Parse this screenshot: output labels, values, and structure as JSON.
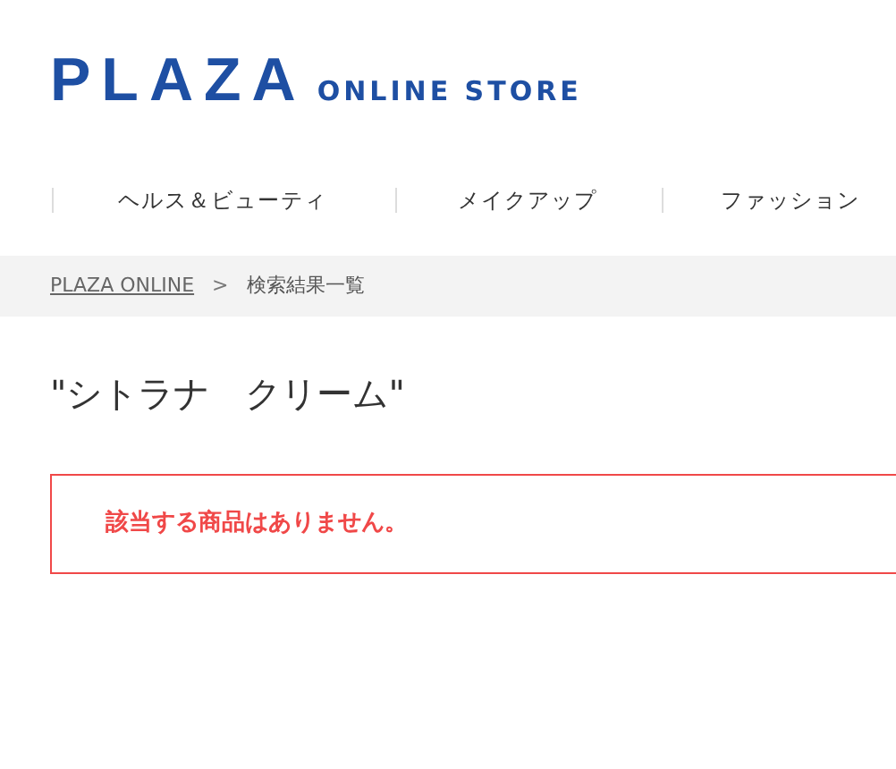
{
  "logo": {
    "brand": "PLAZA",
    "tagline": "ONLINE STORE"
  },
  "nav": [
    {
      "label": "ヘルス＆ビューティ"
    },
    {
      "label": "メイクアップ"
    },
    {
      "label": "ファッション"
    }
  ],
  "breadcrumb": {
    "items": [
      {
        "label": "PLAZA ONLINE",
        "kind": "link"
      },
      {
        "label": "検索結果一覧",
        "kind": "current"
      }
    ],
    "separator": ">"
  },
  "title": "\"シトラナ　クリーム\"",
  "message": "該当する商品はありません。"
}
